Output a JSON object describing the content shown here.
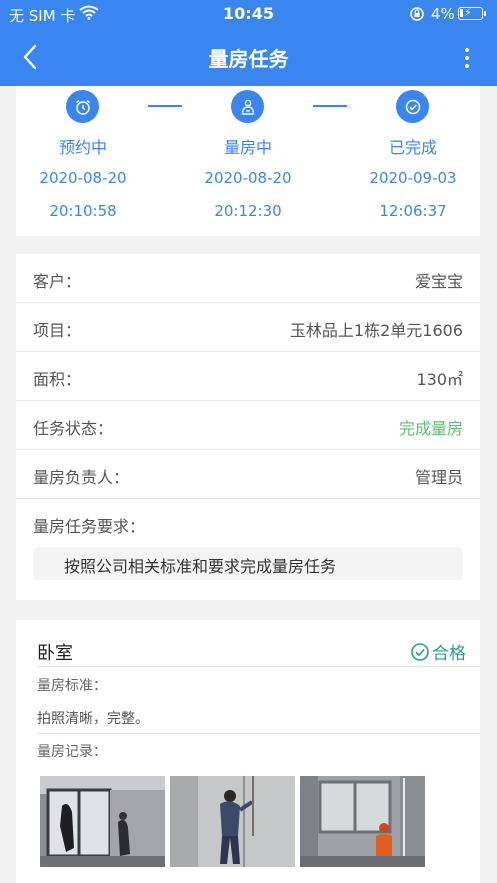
{
  "status_bar": {
    "carrier": "无 SIM 卡",
    "time": "10:45",
    "battery_pct": "4%"
  },
  "nav": {
    "title": "量房任务",
    "back_icon": "chevron-left-icon",
    "more_icon": "more-vertical-icon"
  },
  "progress": {
    "steps": [
      {
        "label": "预约中",
        "date": "2020-08-20",
        "time": "20:10:58",
        "icon": "alarm-clock-icon"
      },
      {
        "label": "量房中",
        "date": "2020-08-20",
        "time": "20:12:30",
        "icon": "measure-person-icon"
      },
      {
        "label": "已完成",
        "date": "2020-09-03",
        "time": "12:06:37",
        "icon": "check-circle-icon"
      }
    ]
  },
  "info": {
    "customer": {
      "label": "客户：",
      "value": "爱宝宝"
    },
    "project": {
      "label": "项目：",
      "value": "玉林品上1栋2单元1606"
    },
    "area": {
      "label": "面积：",
      "value": "130㎡"
    },
    "task_status": {
      "label": "任务状态：",
      "value": "完成量房",
      "color": "#5dc06f"
    },
    "manager": {
      "label": "量房负责人：",
      "value": "管理员"
    },
    "requirement": {
      "label": "量房任务要求：",
      "value": "按照公司相关标准和要求完成量房任务"
    }
  },
  "room": {
    "name": "卧室",
    "status": "合格",
    "status_color": "#2a9d8a",
    "standard_label": "量房标准：",
    "standard_text": "拍照清晰，完整。",
    "record_label": "量房记录：",
    "photos": [
      "room-photo-window",
      "room-photo-wall",
      "room-photo-worker"
    ]
  },
  "colors": {
    "accent": "#3a86f0",
    "success": "#5dc06f"
  }
}
